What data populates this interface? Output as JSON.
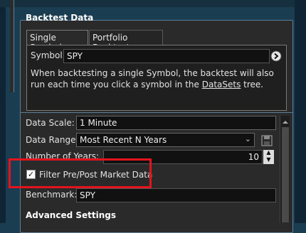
{
  "panel": {
    "title": "Backtest Data"
  },
  "tabs": [
    {
      "label": "Single Symbol",
      "active": true
    },
    {
      "label": "Portfolio Backtest",
      "active": false
    }
  ],
  "symbol": {
    "label": "Symbol:",
    "value": "SPY",
    "go_icon": "arrow-right-circle-icon"
  },
  "description": {
    "before": "When backtesting a single Symbol, the backtest will also run each time you click a symbol in the ",
    "link": "DataSets",
    "after": " tree."
  },
  "data_scale": {
    "label": "Data Scale:",
    "value": "1 Minute"
  },
  "data_range": {
    "label": "Data Range:",
    "value": "Most Recent N Years"
  },
  "number_of_years": {
    "label": "Number of Years:",
    "value": "10"
  },
  "filter": {
    "label": "Filter Pre/Post Market Data",
    "checked": true
  },
  "benchmark": {
    "label": "Benchmark:",
    "value": "SPY"
  },
  "advanced": {
    "label": "Advanced Settings"
  },
  "colors": {
    "highlight_box": "#e3141e",
    "panel_border": "#5e7f93"
  }
}
